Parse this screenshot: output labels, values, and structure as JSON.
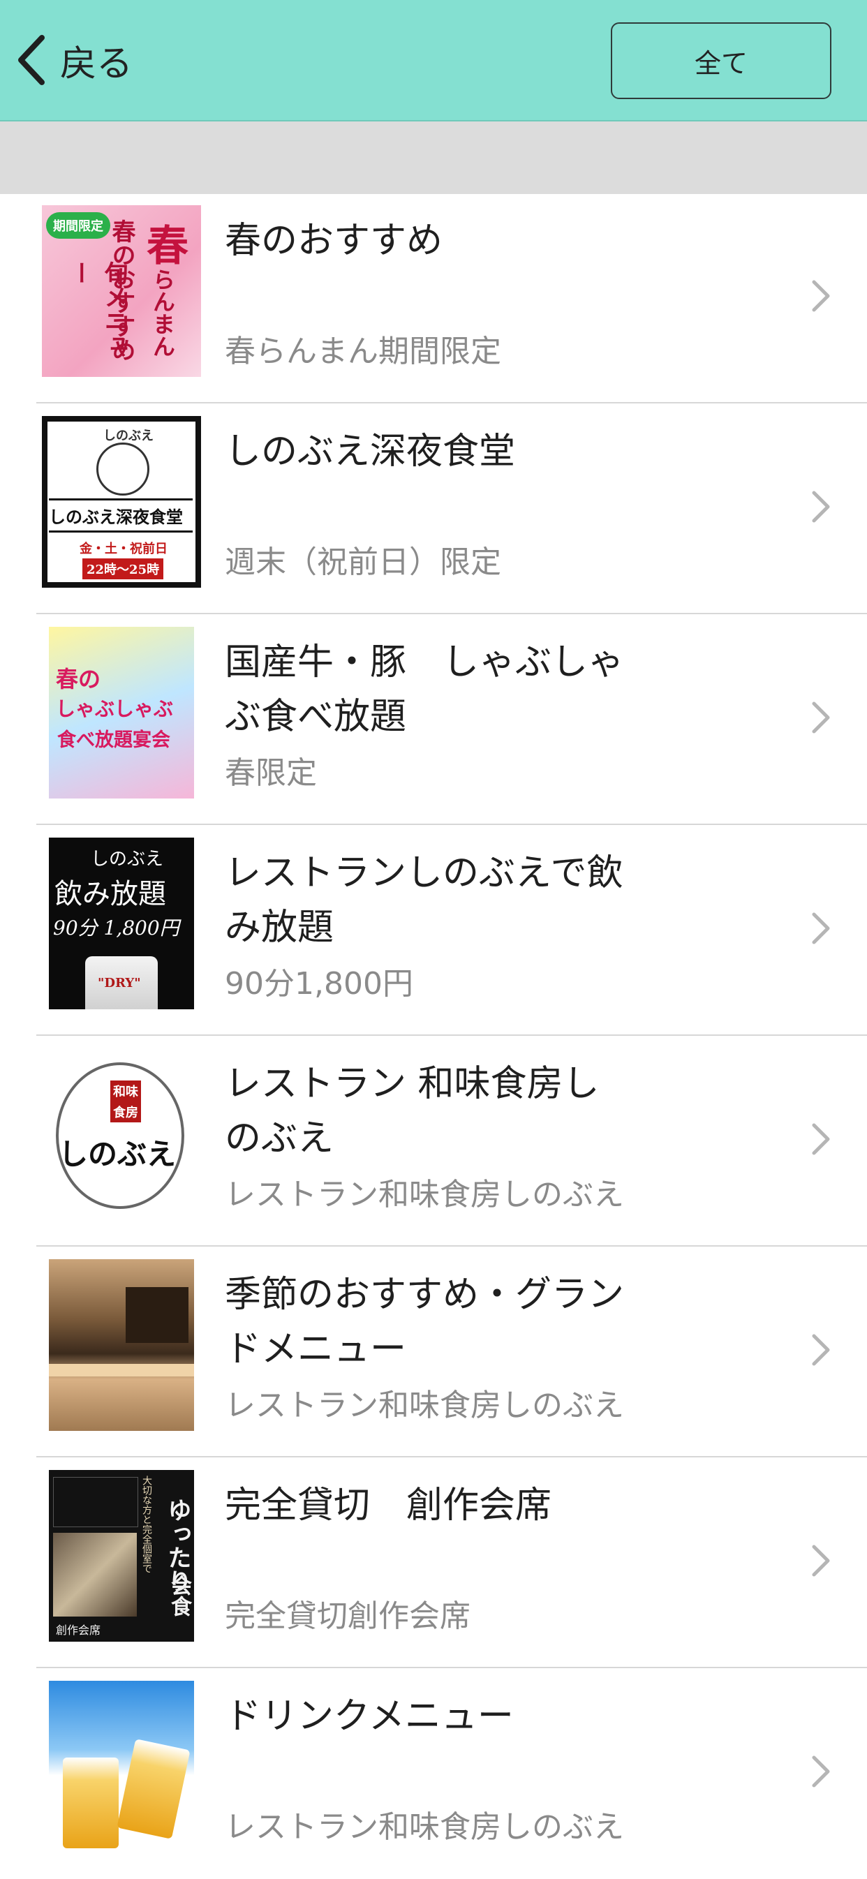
{
  "header": {
    "back_label": "戻る",
    "all_button": "全て"
  },
  "items": [
    {
      "title": "春のおすすめ",
      "subtitle": "春らんまん期間限定",
      "thumb_text": [
        "春",
        "らんまん",
        "春のおすすめ",
        "旬メニュー",
        "期間限定"
      ]
    },
    {
      "title": "しのぶえ深夜食堂",
      "subtitle": "週末（祝前日）限定",
      "thumb_text": [
        "しのぶえ",
        "しのぶえ深夜食堂",
        "金・土・祝前日",
        "22時～25時"
      ]
    },
    {
      "title": "国産牛・豚　しゃぶしゃぶ食べ放題",
      "subtitle": "春限定",
      "thumb_text": [
        "春の",
        "しゃぶしゃぶ",
        "食べ放題宴会"
      ]
    },
    {
      "title": "レストランしのぶえで飲み放題",
      "subtitle": "90分1,800円",
      "thumb_text": [
        "しのぶえ",
        "飲み放題",
        "90分 1,800円",
        "\"DRY\""
      ]
    },
    {
      "title": "レストラン 和味食房しのぶえ",
      "subtitle": "レストラン和味食房しのぶえ",
      "thumb_text": [
        "和味",
        "食房",
        "しのぶえ"
      ]
    },
    {
      "title": "季節のおすすめ・グランドメニュー",
      "subtitle": "レストラン和味食房しのぶえ",
      "thumb_text": []
    },
    {
      "title": "完全貸切　創作会席",
      "subtitle": "完全貸切創作会席",
      "thumb_text": [
        "創作会席",
        "大切な方と完全個室で",
        "ゆったり",
        "会食"
      ]
    },
    {
      "title": "ドリンクメニュー",
      "subtitle": "レストラン和味食房しのぶえ",
      "thumb_text": []
    }
  ],
  "colors": {
    "header_bg": "#84e0d1",
    "band_bg": "#dcdcdc",
    "subtitle": "#8a8a8a"
  },
  "icons": {
    "back": "chevron-left-icon",
    "row_arrow": "chevron-right-icon"
  }
}
